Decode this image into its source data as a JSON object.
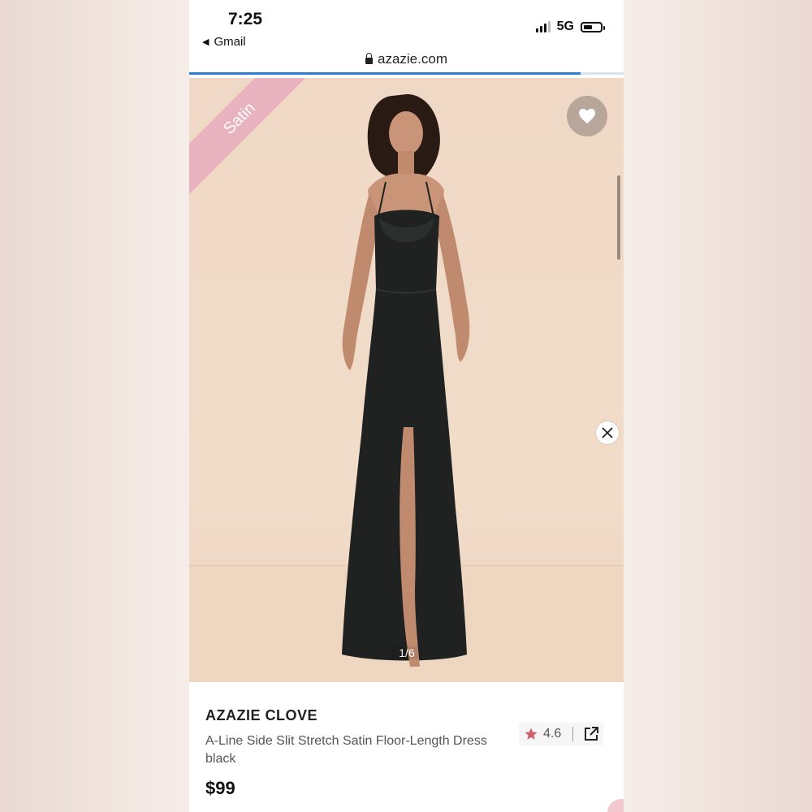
{
  "status_bar": {
    "time": "7:25",
    "back_label": "Gmail",
    "network": "5G"
  },
  "browser": {
    "url": "azazie.com",
    "load_progress": 0.9
  },
  "product_image": {
    "badge": "Satin",
    "image_counter": "1/6"
  },
  "product": {
    "brand": "AZAZIE CLOVE",
    "description": "A-Line Side Slit Stretch Satin Floor-Length Dress black",
    "rating": "4.6",
    "price": "$99"
  },
  "colors": {
    "accent_pink": "#e8b3bf",
    "star": "#d0606a",
    "progress_blue": "#2a7fd4",
    "dress": "#1f2221"
  },
  "icons": [
    "lock-icon",
    "heart-icon",
    "close-icon",
    "star-icon",
    "share-icon",
    "back-arrow-icon",
    "signal-icon",
    "battery-icon"
  ]
}
